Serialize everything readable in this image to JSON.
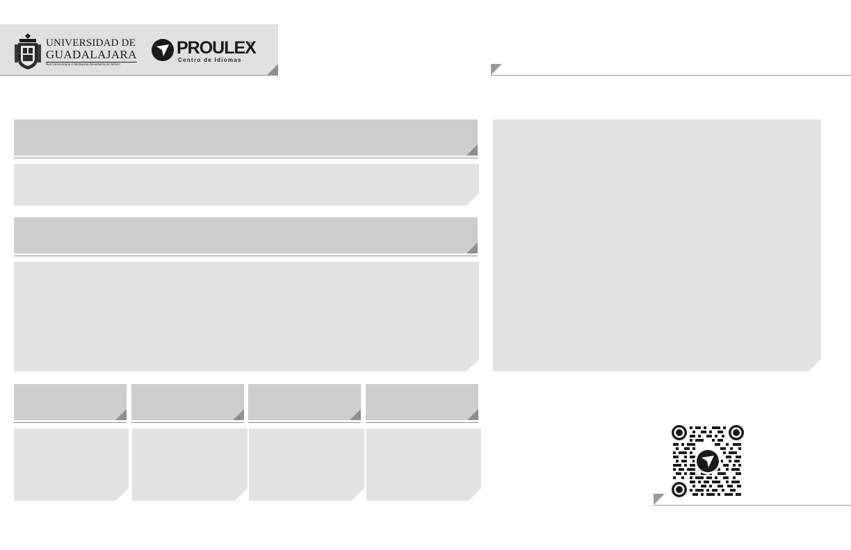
{
  "header": {
    "university": {
      "line1": "UNIVERSIDAD DE",
      "line2": "GUADALAJARA",
      "tagline": "Red Universitaria e Institución Benemérita de Jalisco"
    },
    "proulex": {
      "name": "PROULEX",
      "registered": "®",
      "subtitle": "Centro de Idiomas"
    }
  },
  "colors": {
    "title_panel": "#cdcdcd",
    "content_panel": "#e2e2e2",
    "header_band": "#e0e0e0",
    "rule": "#9a9a9a"
  },
  "icons": [
    "udg-crest-icon",
    "proulex-logo-icon",
    "qr-code-icon"
  ]
}
